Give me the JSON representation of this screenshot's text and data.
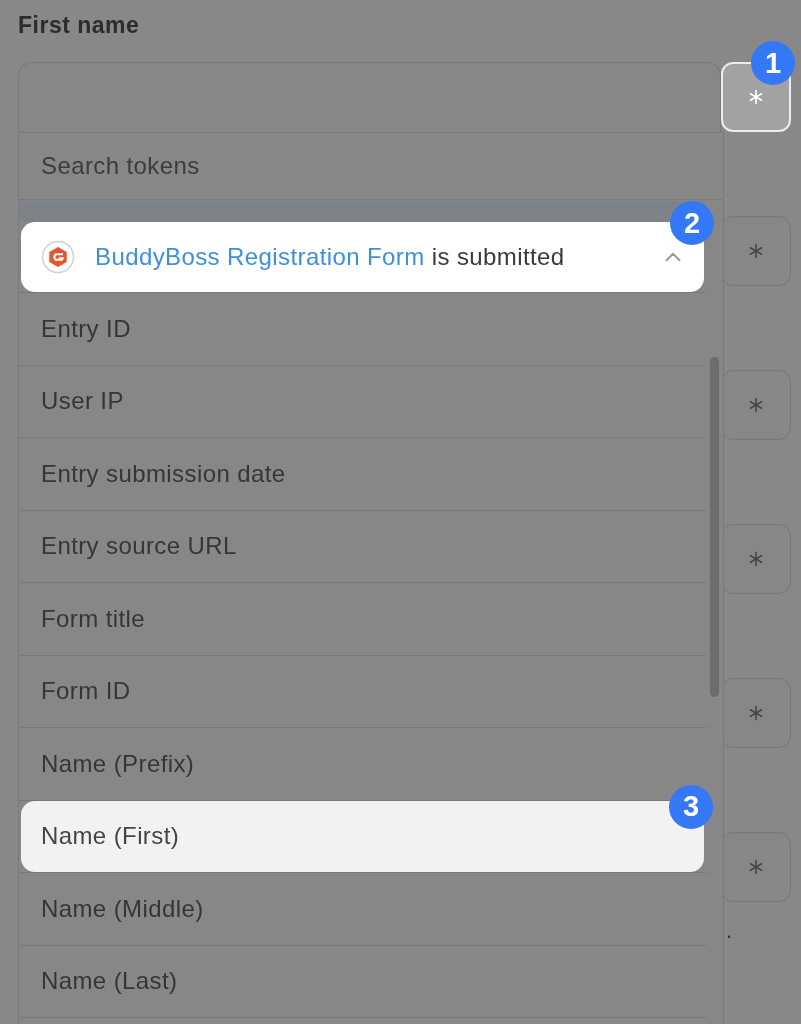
{
  "field": {
    "label": "First name"
  },
  "token_menu": {
    "search": {
      "placeholder": "Search tokens"
    },
    "group": {
      "form_name": "BuddyBoss Registration Form",
      "suffix": "is submitted",
      "expanded": true,
      "spotlit": true,
      "callout": "2"
    },
    "tokens": [
      {
        "label": "Entry ID",
        "spotlit": false
      },
      {
        "label": "User IP",
        "spotlit": false
      },
      {
        "label": "Entry submission date",
        "spotlit": false
      },
      {
        "label": "Entry source URL",
        "spotlit": false
      },
      {
        "label": "Form title",
        "spotlit": false
      },
      {
        "label": "Form ID",
        "spotlit": false
      },
      {
        "label": "Name (Prefix)",
        "spotlit": false
      },
      {
        "label": "Name (First)",
        "spotlit": true,
        "callout": "3"
      },
      {
        "label": "Name (Middle)",
        "spotlit": false
      },
      {
        "label": "Name (Last)",
        "spotlit": false
      }
    ]
  },
  "token_buttons": [
    {
      "spotlit": true,
      "callout": "1"
    },
    {
      "spotlit": false
    },
    {
      "spotlit": false
    },
    {
      "spotlit": false
    },
    {
      "spotlit": false
    },
    {
      "spotlit": false
    }
  ],
  "cut_text": "."
}
